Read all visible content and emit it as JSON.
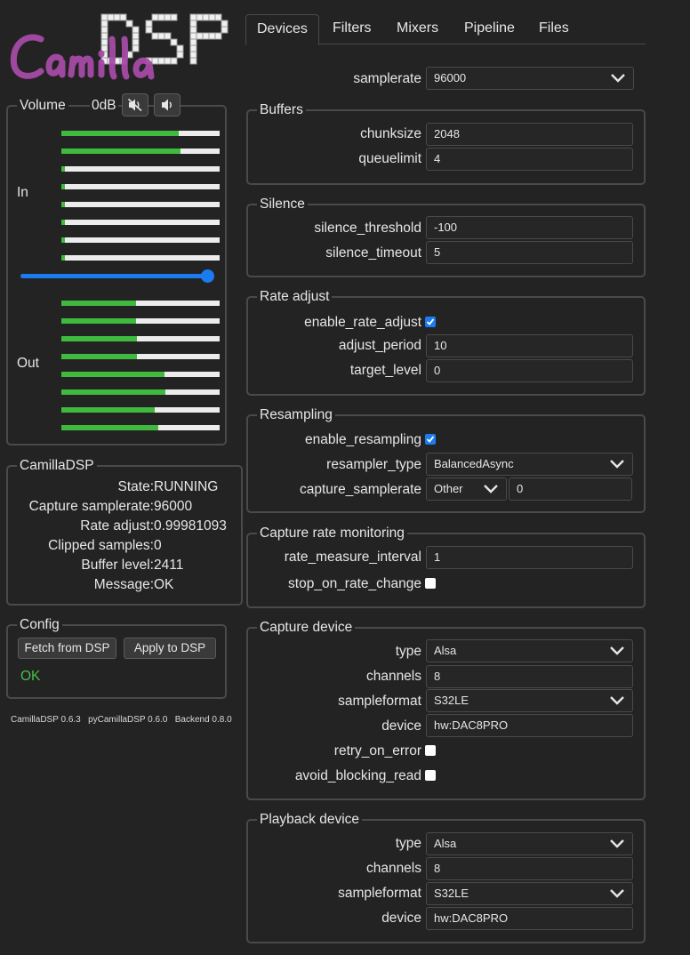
{
  "logo": {
    "text": "CamillaDSP"
  },
  "volume": {
    "legend": "Volume",
    "level": "0dB",
    "mute_icon": "speaker-muted-icon",
    "speaker_icon": "speaker-icon",
    "in_label": "In",
    "out_label": "Out",
    "slider_position_fraction": 0.98,
    "in_meters": [
      0.74,
      0.75,
      0.02,
      0.02,
      0.02,
      0.02,
      0.02,
      0.02
    ],
    "out_meters": [
      0.47,
      0.47,
      0.48,
      0.48,
      0.65,
      0.66,
      0.59,
      0.61
    ],
    "meter_color": "#3fba3f",
    "slider_color": "#1a7cf0"
  },
  "status": {
    "legend": "CamillaDSP",
    "rows": [
      {
        "key": "State:",
        "value": "RUNNING"
      },
      {
        "key": "Capture samplerate:",
        "value": "96000"
      },
      {
        "key": "Rate adjust:",
        "value": "0.99981093"
      },
      {
        "key": "Clipped samples:",
        "value": "0"
      },
      {
        "key": "Buffer level:",
        "value": "2411"
      },
      {
        "key": "Message:",
        "value": "OK"
      }
    ]
  },
  "config": {
    "legend": "Config",
    "fetch_label": "Fetch from DSP",
    "apply_label": "Apply to DSP",
    "result": "OK",
    "result_color": "#46c046"
  },
  "versions": "CamillaDSP 0.6.3   pyCamillaDSP 0.6.0   Backend 0.8.0",
  "tabs": [
    "Devices",
    "Filters",
    "Mixers",
    "Pipeline",
    "Files"
  ],
  "form": {
    "samplerate": {
      "label": "samplerate",
      "value": "96000"
    },
    "buffers": {
      "legend": "Buffers",
      "chunksize": {
        "label": "chunksize",
        "value": "2048"
      },
      "queuelimit": {
        "label": "queuelimit",
        "value": "4"
      }
    },
    "silence": {
      "legend": "Silence",
      "threshold": {
        "label": "silence_threshold",
        "value": "-100"
      },
      "timeout": {
        "label": "silence_timeout",
        "value": "5"
      }
    },
    "rate_adjust": {
      "legend": "Rate adjust",
      "enable": {
        "label": "enable_rate_adjust",
        "checked": true
      },
      "period": {
        "label": "adjust_period",
        "value": "10"
      },
      "target": {
        "label": "target_level",
        "value": "0"
      }
    },
    "resampling": {
      "legend": "Resampling",
      "enable": {
        "label": "enable_resampling",
        "checked": true
      },
      "type": {
        "label": "resampler_type",
        "value": "BalancedAsync"
      },
      "capture_samplerate": {
        "label": "capture_samplerate",
        "select": "Other",
        "value": "0"
      }
    },
    "rate_monitoring": {
      "legend": "Capture rate monitoring",
      "interval": {
        "label": "rate_measure_interval",
        "value": "1"
      },
      "stop": {
        "label": "stop_on_rate_change",
        "checked": false
      }
    },
    "capture": {
      "legend": "Capture device",
      "type": {
        "label": "type",
        "value": "Alsa"
      },
      "channels": {
        "label": "channels",
        "value": "8"
      },
      "sampleformat": {
        "label": "sampleformat",
        "value": "S32LE"
      },
      "device": {
        "label": "device",
        "value": "hw:DAC8PRO"
      },
      "retry": {
        "label": "retry_on_error",
        "checked": false
      },
      "avoid": {
        "label": "avoid_blocking_read",
        "checked": false
      }
    },
    "playback": {
      "legend": "Playback device",
      "type": {
        "label": "type",
        "value": "Alsa"
      },
      "channels": {
        "label": "channels",
        "value": "8"
      },
      "sampleformat": {
        "label": "sampleformat",
        "value": "S32LE"
      },
      "device": {
        "label": "device",
        "value": "hw:DAC8PRO"
      }
    }
  }
}
